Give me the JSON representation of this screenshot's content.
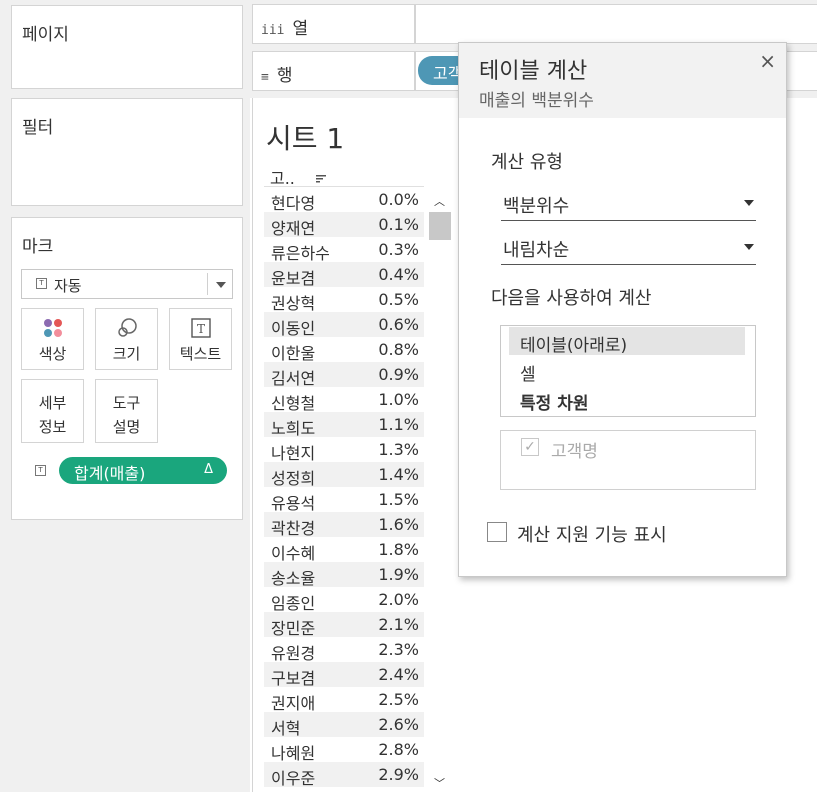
{
  "panels": {
    "pages": "페이지",
    "filters": "필터",
    "marks": "마크"
  },
  "marks": {
    "type_select": "자동",
    "cards": {
      "color": "색상",
      "size": "크기",
      "text": "텍스트",
      "detail_1": "세부",
      "detail_2": "정보",
      "tooltip_1": "도구",
      "tooltip_2": "설명"
    },
    "pill": "합계(매출)",
    "pill_delta": "Δ"
  },
  "shelves": {
    "columns": "열",
    "rows": "행",
    "rows_pill": "고객"
  },
  "sheet": {
    "title": "시트 1",
    "header": "고..",
    "rows": [
      {
        "name": "현다영",
        "value": "0.0%"
      },
      {
        "name": "양재연",
        "value": "0.1%"
      },
      {
        "name": "류은하수",
        "value": "0.3%"
      },
      {
        "name": "윤보겸",
        "value": "0.4%"
      },
      {
        "name": "권상혁",
        "value": "0.5%"
      },
      {
        "name": "이동인",
        "value": "0.6%"
      },
      {
        "name": "이한울",
        "value": "0.8%"
      },
      {
        "name": "김서연",
        "value": "0.9%"
      },
      {
        "name": "신형철",
        "value": "1.0%"
      },
      {
        "name": "노희도",
        "value": "1.1%"
      },
      {
        "name": "나현지",
        "value": "1.3%"
      },
      {
        "name": "성정희",
        "value": "1.4%"
      },
      {
        "name": "유용석",
        "value": "1.5%"
      },
      {
        "name": "곽찬경",
        "value": "1.6%"
      },
      {
        "name": "이수혜",
        "value": "1.8%"
      },
      {
        "name": "송소율",
        "value": "1.9%"
      },
      {
        "name": "임종인",
        "value": "2.0%"
      },
      {
        "name": "장민준",
        "value": "2.1%"
      },
      {
        "name": "유원경",
        "value": "2.3%"
      },
      {
        "name": "구보겸",
        "value": "2.4%"
      },
      {
        "name": "권지애",
        "value": "2.5%"
      },
      {
        "name": "서혁",
        "value": "2.6%"
      },
      {
        "name": "나혜원",
        "value": "2.8%"
      },
      {
        "name": "이우준",
        "value": "2.9%"
      }
    ]
  },
  "dialog": {
    "title": "테이블 계산",
    "subtitle": "매출의 백분위수",
    "close": "×",
    "calc_type_label": "계산 유형",
    "calc_type_value": "백분위수",
    "order_value": "내림차순",
    "compute_using_label": "다음을 사용하여 계산",
    "compute_options": [
      "테이블(아래로)",
      "셀",
      "특정 차원"
    ],
    "dimension": "고객명",
    "show_assist": "계산 지원 기능 표시"
  },
  "colors": {
    "accent_pill": "#4e97b5",
    "measure_pill": "#1aa67d",
    "selected_option": "#e4e4e4"
  }
}
